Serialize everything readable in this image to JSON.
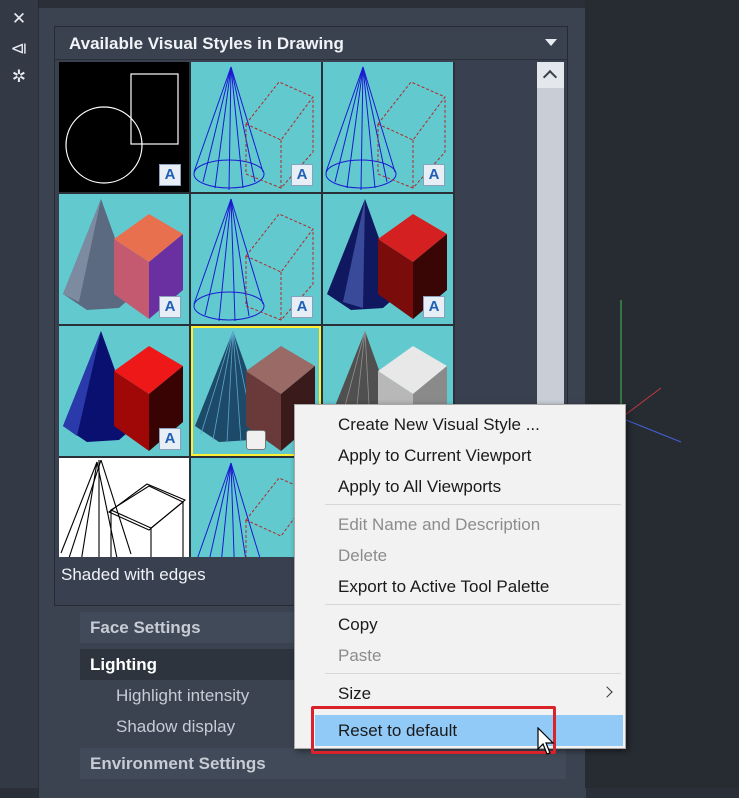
{
  "palette": {
    "panel_title": "Available Visual Styles in Drawing",
    "status_text": "Shaded with edges",
    "strip_icons": [
      "close-icon",
      "auto-hide-icon",
      "properties-icon"
    ]
  },
  "properties": {
    "rows": [
      {
        "label": "Face Settings"
      },
      {
        "label": "Lighting"
      },
      {
        "label": "Highlight intensity"
      },
      {
        "label": "Shadow display"
      },
      {
        "label": "Environment Settings"
      }
    ]
  },
  "context_menu": {
    "items": [
      {
        "label": "Create New Visual Style ..."
      },
      {
        "label": "Apply to Current Viewport"
      },
      {
        "label": "Apply to All Viewports"
      },
      {
        "label": "Edit Name and Description"
      },
      {
        "label": "Delete"
      },
      {
        "label": "Export to Active Tool Palette"
      },
      {
        "label": "Copy"
      },
      {
        "label": "Paste"
      },
      {
        "label": "Size"
      },
      {
        "label": "Reset to default"
      }
    ]
  },
  "colors": {
    "thumb_bg": "#62cacf",
    "selected_border": "#ffee33",
    "highlight_border": "#d9222a",
    "menu_hover": "#91c9f7"
  }
}
